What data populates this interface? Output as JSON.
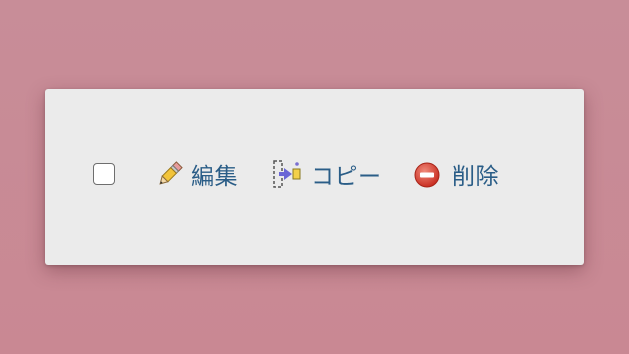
{
  "background_color": "#c98a95",
  "toolbar": {
    "select_checkbox": {
      "checked": false
    },
    "actions": [
      {
        "label": "編集",
        "icon": "pencil-icon"
      },
      {
        "label": "コピー",
        "icon": "copy-icon"
      },
      {
        "label": "削除",
        "icon": "delete-icon"
      }
    ]
  },
  "colors": {
    "link_text": "#2a5d87",
    "delete_icon": "#d63b2f",
    "panel_background": "#ebebeb"
  }
}
